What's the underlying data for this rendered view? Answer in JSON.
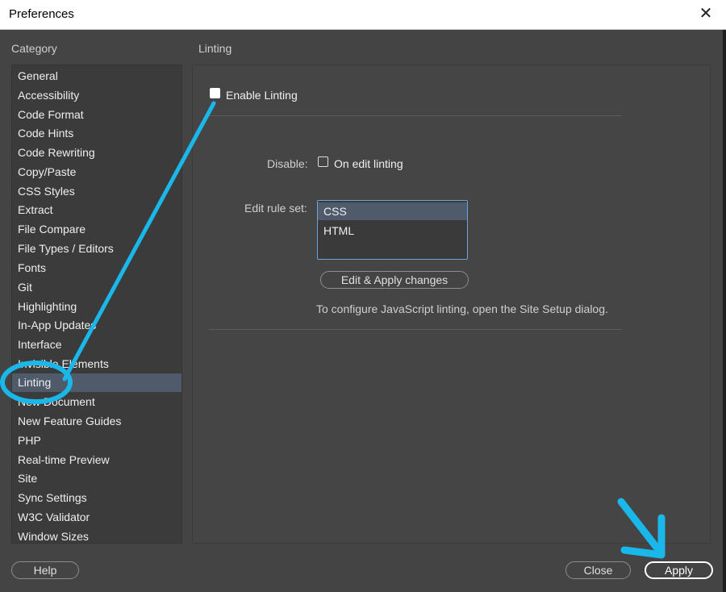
{
  "window": {
    "title": "Preferences",
    "close_glyph": "✕"
  },
  "category": {
    "label": "Category",
    "items": [
      {
        "label": "General"
      },
      {
        "label": "Accessibility"
      },
      {
        "label": "Code Format"
      },
      {
        "label": "Code Hints"
      },
      {
        "label": "Code Rewriting"
      },
      {
        "label": "Copy/Paste"
      },
      {
        "label": "CSS Styles"
      },
      {
        "label": "Extract"
      },
      {
        "label": "File Compare"
      },
      {
        "label": "File Types / Editors"
      },
      {
        "label": "Fonts"
      },
      {
        "label": "Git"
      },
      {
        "label": "Highlighting"
      },
      {
        "label": "In-App Updates"
      },
      {
        "label": "Interface"
      },
      {
        "label": "Invisible Elements"
      },
      {
        "label": "Linting"
      },
      {
        "label": "New Document"
      },
      {
        "label": "New Feature Guides"
      },
      {
        "label": "PHP"
      },
      {
        "label": "Real-time Preview"
      },
      {
        "label": "Site"
      },
      {
        "label": "Sync Settings"
      },
      {
        "label": "W3C Validator"
      },
      {
        "label": "Window Sizes"
      }
    ],
    "selected": "Linting"
  },
  "linting": {
    "title": "Linting",
    "enable_label": "Enable Linting",
    "enable_checked": false,
    "disable_label": "Disable:",
    "on_edit_label": "On edit linting",
    "on_edit_checked": false,
    "rule_set_label": "Edit rule set:",
    "rule_sets": [
      "CSS",
      "HTML"
    ],
    "selected_rule_set": "CSS",
    "edit_button": "Edit  & Apply changes",
    "js_note": "To configure JavaScript linting, open the Site Setup dialog."
  },
  "buttons": {
    "help": "Help",
    "close": "Close",
    "apply": "Apply"
  },
  "annotation": {
    "color": "#1ab7ea"
  }
}
